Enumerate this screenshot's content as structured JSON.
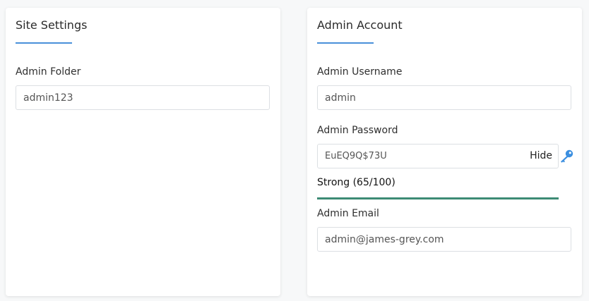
{
  "site_settings": {
    "title": "Site Settings",
    "admin_folder_label": "Admin Folder",
    "admin_folder_value": "admin123"
  },
  "admin_account": {
    "title": "Admin Account",
    "username_label": "Admin Username",
    "username_value": "admin",
    "password_label": "Admin Password",
    "password_value": "EuEQ9Q$73U",
    "hide_label": "Hide",
    "strength_text": "Strong (65/100)",
    "strength_level": 1.0,
    "email_label": "Admin Email",
    "email_value": "admin@james-grey.com"
  },
  "colors": {
    "accent": "#4a90d9",
    "strength": "#3d8b75",
    "key_icon": "#3b8fe0"
  },
  "icons": {
    "password_generate": "key-icon"
  }
}
